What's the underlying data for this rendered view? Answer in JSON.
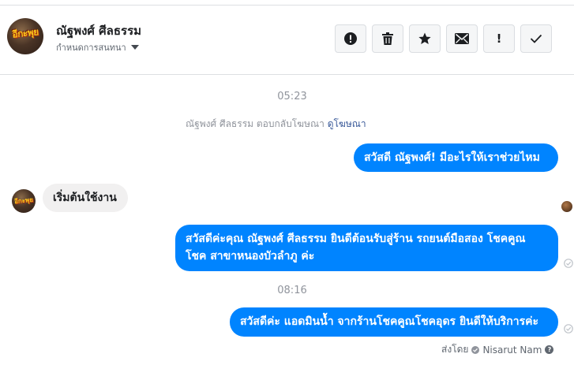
{
  "header": {
    "contact_name": "ณัฐพงศ์ ศีลธรรม",
    "assign_label": "กำหนดการสนทนา",
    "avatar_logo_text": "อีกะพุย",
    "toolbar": [
      {
        "icon": "exclamation-circle-icon"
      },
      {
        "icon": "trash-icon"
      },
      {
        "icon": "star-icon"
      },
      {
        "icon": "envelope-icon"
      },
      {
        "icon": "exclamation-icon",
        "text": "!"
      },
      {
        "icon": "check-icon"
      }
    ]
  },
  "conversation": {
    "time_1": "05:23",
    "notice": {
      "text": "ณัฐพงศ์ ศีลธรรม ตอบกลับโฆษณา",
      "link": "ดูโฆษณา"
    },
    "msg_out_1": "สวัสดี ณัฐพงศ์! มีอะไรให้เราช่วยไหม",
    "msg_in_1": "เริ่มต้นใช้งาน",
    "msg_out_2_line1": "สวัสดีค่ะคุณ ณัฐพงศ์ ศีลธรรม ยินดีต้อนรับสู่ร้าน รถยนต์มือสอง โชคคูณ",
    "msg_out_2_line2": "โชค สาขาหนองบัวลำภู ค่ะ",
    "time_2": "08:16",
    "msg_out_3": "สวัสดีค่ะ แอดมินน้ำ จากร้านโชคคูณโชคอุดร ยินดีให้บริการค่ะ",
    "sent_by_label": "ส่งโดย",
    "sent_by_name": "Nisarut Nam"
  },
  "colors": {
    "accent": "#0084ff",
    "incoming_bubble": "#f1f0f0",
    "muted_text": "#90949c",
    "link": "#385898"
  }
}
